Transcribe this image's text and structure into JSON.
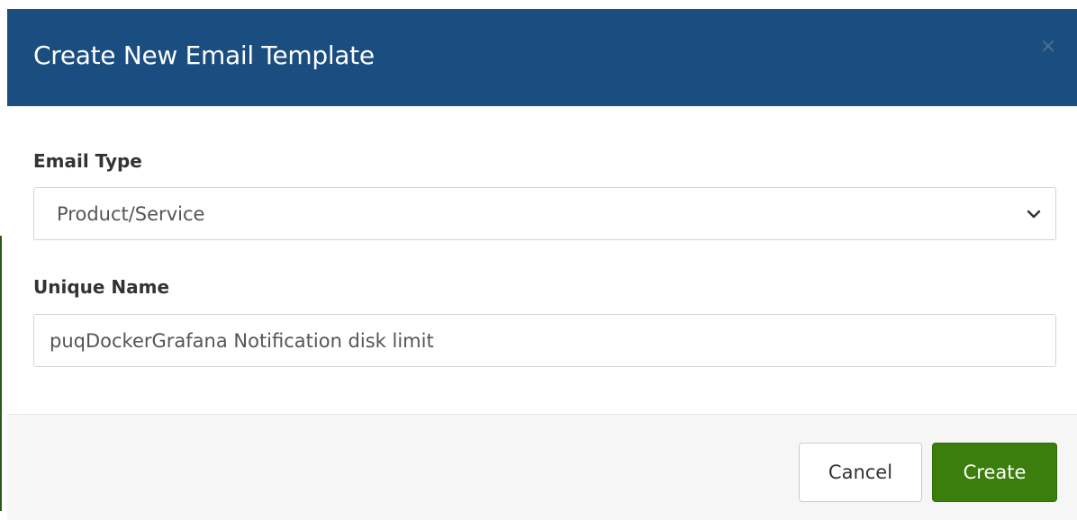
{
  "modal": {
    "title": "Create New Email Template",
    "close_icon": "close-icon"
  },
  "form": {
    "email_type": {
      "label": "Email Type",
      "selected": "Product/Service"
    },
    "unique_name": {
      "label": "Unique Name",
      "value": "puqDockerGrafana Notification disk limit"
    }
  },
  "footer": {
    "cancel_label": "Cancel",
    "create_label": "Create"
  },
  "colors": {
    "header_bg": "#1b4e80",
    "primary_button": "#3b7e0b",
    "footer_bg": "#f6f6f6"
  }
}
